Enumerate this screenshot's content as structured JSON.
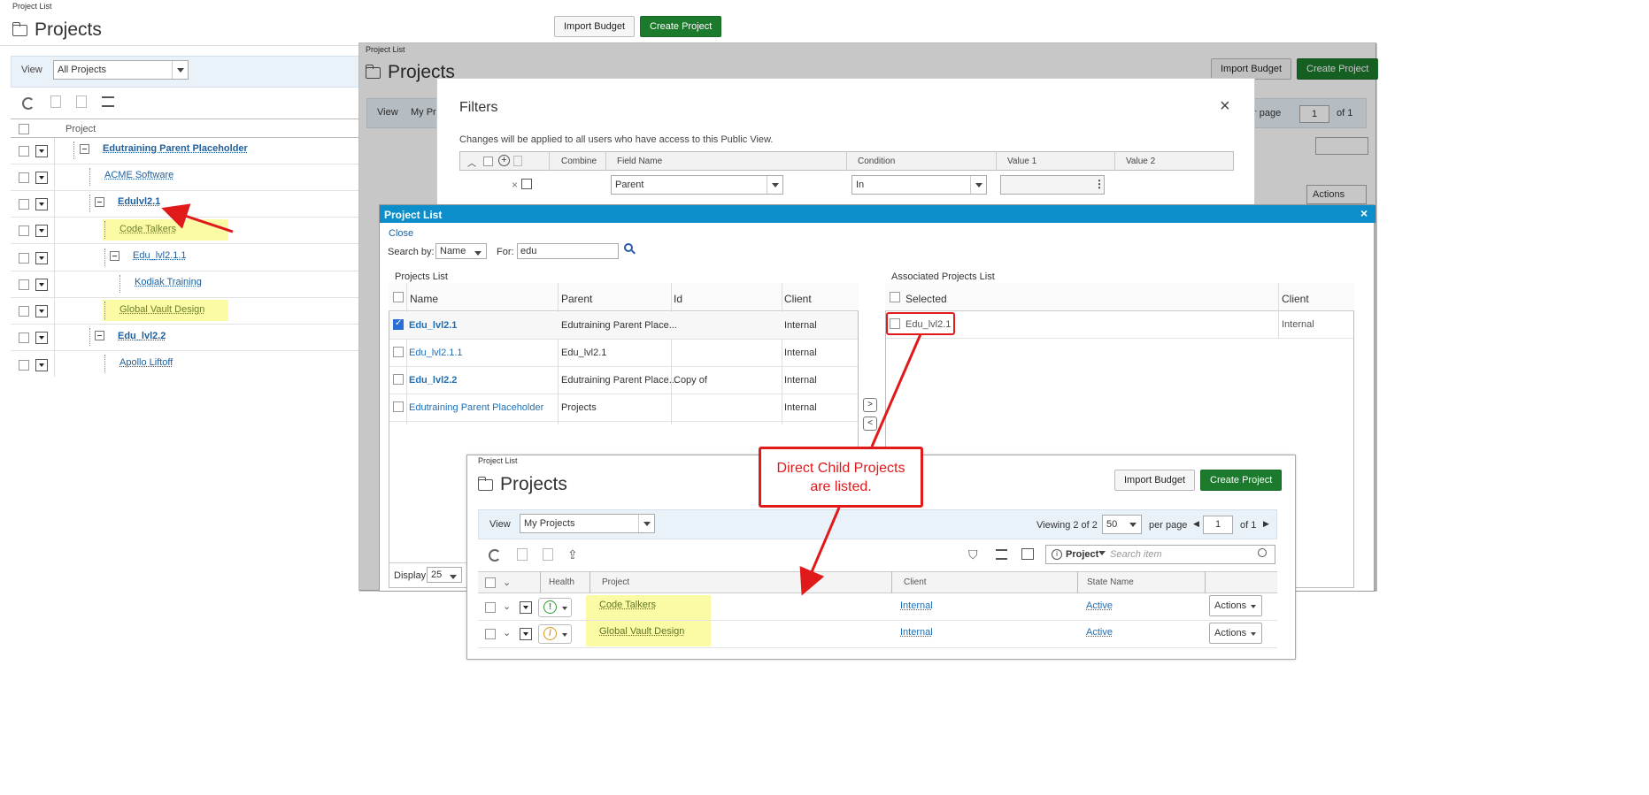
{
  "layer1": {
    "crumb": "Project List",
    "title": "Projects",
    "import_label": "Import Budget",
    "create_label": "Create Project",
    "view_label": "View",
    "view_value": "All Projects",
    "col_project": "Project",
    "rows": [
      {
        "name": "Edutraining Parent Placeholder"
      },
      {
        "name": "ACME Software"
      },
      {
        "name": "Edulvl2.1"
      },
      {
        "name": "Code Talkers"
      },
      {
        "name": "Edu_lvl2.1.1"
      },
      {
        "name": "Kodiak Training"
      },
      {
        "name": "Global Vault Design"
      },
      {
        "name": "Edu_lvl2.2"
      },
      {
        "name": "Apollo Liftoff"
      }
    ]
  },
  "layer2": {
    "crumb": "Project List",
    "title": "Projects",
    "import_label": "Import Budget",
    "create_label": "Create Project",
    "view_label": "View",
    "view_value": "My Pr",
    "per_page": "r page",
    "page_num": "1",
    "of_pages": "of 1",
    "actions": "Actions"
  },
  "filters": {
    "title": "Filters",
    "note": "Changes will be applied to all users who have access to this Public View.",
    "cols": {
      "combine": "Combine",
      "field": "Field Name",
      "cond": "Condition",
      "v1": "Value 1",
      "v2": "Value 2"
    },
    "field_value": "Parent",
    "cond_value": "In"
  },
  "picker": {
    "title": "Project List",
    "close_label": "Close",
    "search_by_label": "Search by:",
    "search_by_value": "Name",
    "for_label": "For:",
    "for_value": "edu",
    "projects_list_label": "Projects List",
    "associated_label": "Associated Projects List",
    "cols": {
      "name": "Name",
      "parent": "Parent",
      "id": "Id",
      "client": "Client",
      "selected": "Selected",
      "client2": "Client"
    },
    "rows": [
      {
        "name": "Edu_lvl2.1",
        "parent": "Edutraining Parent Place...",
        "id": "",
        "client": "Internal"
      },
      {
        "name": "Edu_lvl2.1.1",
        "parent": "Edu_lvl2.1",
        "id": "",
        "client": "Internal"
      },
      {
        "name": "Edu_lvl2.2",
        "parent": "Edutraining Parent Place...",
        "id": "Copy of",
        "client": "Internal"
      },
      {
        "name": "Edutraining Parent Placeholder",
        "parent": "Projects",
        "id": "",
        "client": "Internal"
      }
    ],
    "assoc_rows": [
      {
        "name": "Edu_lvl2.1",
        "client": "Internal"
      }
    ],
    "display_label": "Display",
    "display_value": "25"
  },
  "callout": {
    "text_line1": "Direct Child Projects",
    "text_line2": "are listed."
  },
  "layer3": {
    "crumb": "Project List",
    "title": "Projects",
    "import_label": "Import Budget",
    "create_label": "Create Project",
    "view_label": "View",
    "view_value": "My Projects",
    "viewing": "Viewing 2 of 2",
    "per_page_value": "50",
    "per_page_label": "per page",
    "page_num": "1",
    "of_pages": "of 1",
    "search_scope": "Project",
    "search_placeholder": "Search item",
    "cols": {
      "health": "Health",
      "project": "Project",
      "client": "Client",
      "state": "State Name"
    },
    "rows": [
      {
        "project": "Code Talkers",
        "client": "Internal",
        "state": "Active",
        "actions": "Actions"
      },
      {
        "project": "Global Vault Design",
        "client": "Internal",
        "state": "Active",
        "actions": "Actions"
      }
    ]
  },
  "colors": {
    "accent_blue": "#0b8ec9",
    "green": "#1c7a2c",
    "callout_red": "#e0191b",
    "highlight": "#fbfba6"
  }
}
